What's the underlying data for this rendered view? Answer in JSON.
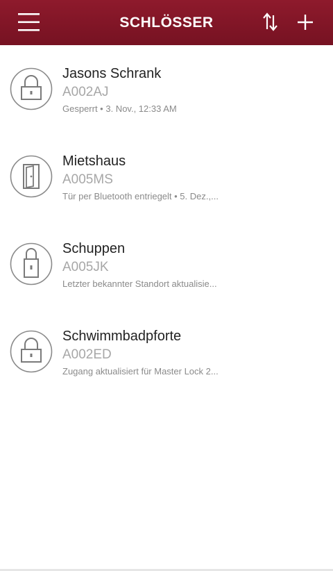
{
  "header": {
    "title": "SCHLÖSSER",
    "menu_icon": "hamburger-menu-icon",
    "sort_icon": "sort-arrows-icon",
    "add_icon": "plus-icon",
    "background": "#8e1a2c"
  },
  "locks": [
    {
      "name": "Jasons Schrank",
      "code": "A002AJ",
      "status": "Gesperrt • 3. Nov., 12:33 AM",
      "icon": "padlock-icon"
    },
    {
      "name": "Mietshaus",
      "code": "A005MS",
      "status": "Tür per Bluetooth entriegelt • 5. Dez.,...",
      "icon": "door-icon"
    },
    {
      "name": "Schuppen",
      "code": "A005JK",
      "status": "Letzter bekannter Standort aktualisie...",
      "icon": "tall-padlock-icon"
    },
    {
      "name": "Schwimmbadpforte",
      "code": "A002ED",
      "status": "Zugang aktualisiert für Master Lock 2...",
      "icon": "padlock-icon"
    }
  ]
}
